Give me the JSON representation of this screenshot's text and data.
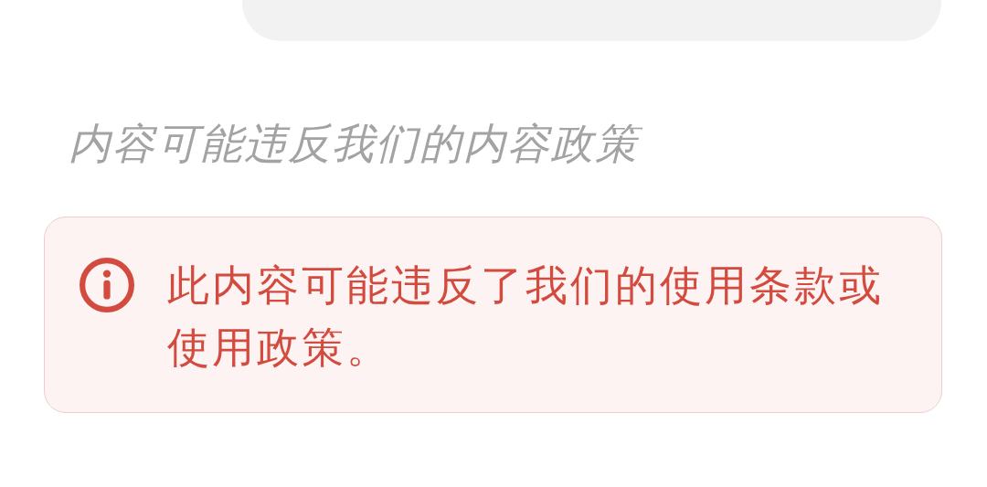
{
  "notice": {
    "text": "内容可能违反我们的内容政策"
  },
  "alert": {
    "kind": "error",
    "text": "此内容可能违反了我们的使用条款或使用政策。"
  }
}
